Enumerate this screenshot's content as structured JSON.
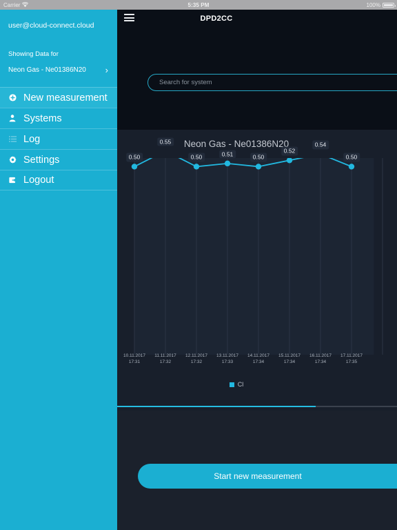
{
  "status_bar": {
    "carrier": "Carrier",
    "wifi_icon": "wifi-icon",
    "time": "5:35 PM",
    "battery_percent": "100%",
    "battery_icon": "battery-full-icon"
  },
  "sidebar": {
    "account_email": "user@cloud-connect.cloud",
    "showing_label": "Showing Data for",
    "selected_system": "Neon Gas - Ne01386N20",
    "chevron": "›",
    "background_color": "#1bafd2",
    "items": [
      {
        "label": "New measurement",
        "icon": "plus-circle-icon",
        "active": true
      },
      {
        "label": "Systems",
        "icon": "user-icon",
        "active": false
      },
      {
        "label": "Log",
        "icon": "list-icon",
        "active": false
      },
      {
        "label": "Settings",
        "icon": "gear-icon",
        "active": false
      },
      {
        "label": "Logout",
        "icon": "logout-icon",
        "active": false
      }
    ]
  },
  "topbar": {
    "menu_icon": "hamburger-icon",
    "title": "DPD2CC"
  },
  "search": {
    "placeholder": "Search for system",
    "value": "",
    "border_color": "#26a8c6"
  },
  "scrollbar": {
    "thumb_percent": 71,
    "thumb_color": "#25bde2"
  },
  "footer": {
    "cta_label": "Start new measurement",
    "cta_color": "#1bafd2"
  },
  "chart_data": {
    "type": "line",
    "title": "Neon Gas - Ne01386N20",
    "xlabel": "",
    "ylabel": "",
    "grid": true,
    "legend_position": "bottom",
    "series": [
      {
        "name": "Cl",
        "color": "#22b8e0",
        "values": [
          0.5,
          0.55,
          0.5,
          0.51,
          0.5,
          0.52,
          0.54,
          0.5
        ]
      }
    ],
    "categories": [
      "10.11.2017\n17:31",
      "11.11.2017\n17:32",
      "12.11.2017\n17:32",
      "13.11.2017\n17:33",
      "14.11.2017\n17:34",
      "15.11.2017\n17:34",
      "16.11.2017\n17:34",
      "17.11.2017\n17:35"
    ],
    "x_tick_dates": [
      "10.11.2017",
      "11.11.2017",
      "12.11.2017",
      "13.11.2017",
      "14.11.2017",
      "15.11.2017",
      "16.11.2017",
      "17.11.2017"
    ],
    "x_tick_times": [
      "17:31",
      "17:32",
      "17:32",
      "17:33",
      "17:34",
      "17:34",
      "17:34",
      "17:35"
    ],
    "data_labels": [
      "0.50",
      "0.55",
      "0.50",
      "0.51",
      "0.50",
      "0.52",
      "0.54",
      "0.50"
    ],
    "ylim": [
      0.0,
      0.58
    ]
  }
}
